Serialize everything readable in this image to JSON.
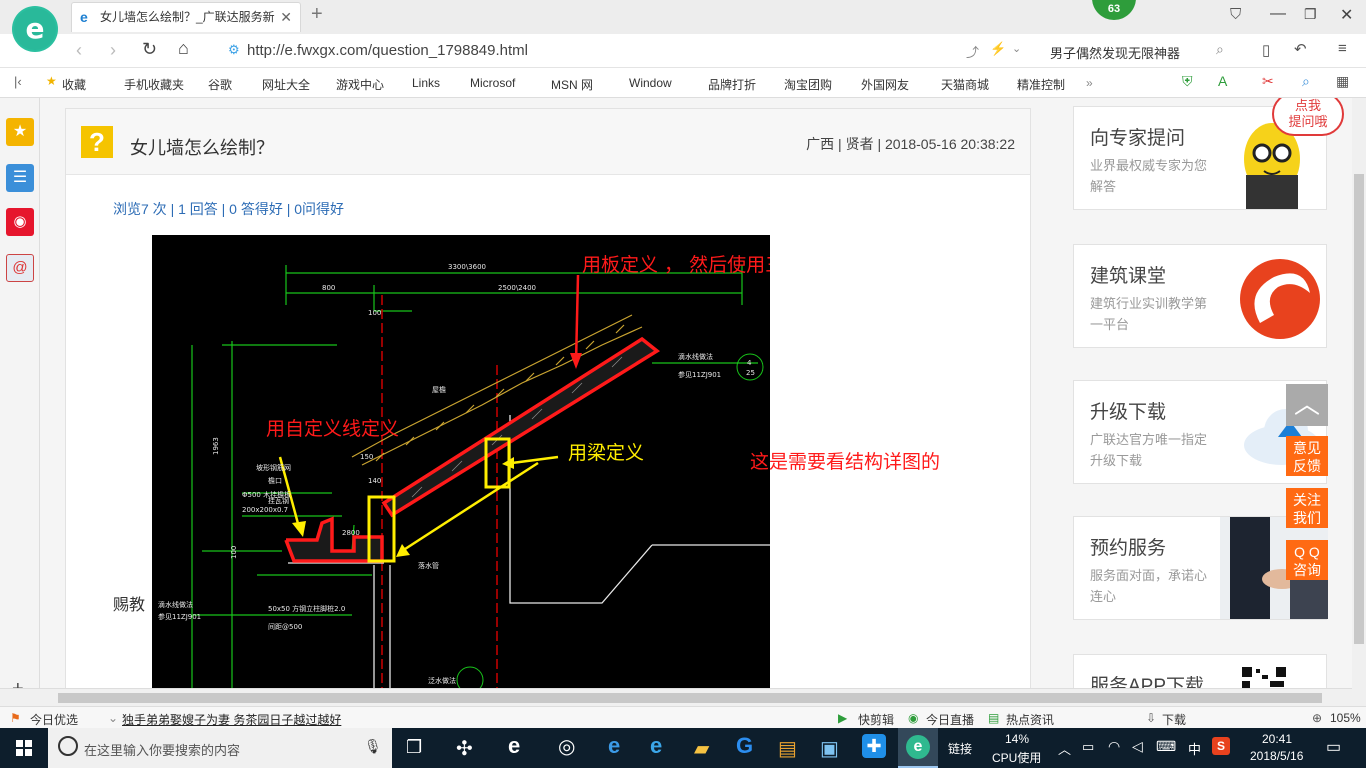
{
  "browser": {
    "tab_title": "女儿墙怎么绘制？_广联达服务新",
    "url": "http://e.fwxgx.com/question_1798849.html",
    "search_hint": "男子偶然发现无限神器",
    "badge": "63"
  },
  "bookmarks": [
    "收藏",
    "手机收藏夹",
    "谷歌",
    "网址大全",
    "游戏中心",
    "Links",
    "Microsof",
    "MSN 网",
    "Window",
    "品牌打折",
    "淘宝团购",
    "外国网友",
    "天猫商城",
    "精准控制"
  ],
  "question": {
    "title": "女儿墙怎么绘制？",
    "meta": "广西 | 贤者 | 2018-05-16 20:38:22",
    "stats": "浏览7 次 | 1 回答 | 0 答得好 | 0问得好",
    "side_text": "赐教"
  },
  "drawing": {
    "note_slab": "用板定义 ， 然后使用三点定义斜板功能",
    "note_line": "用自定义线定义",
    "note_beam": "用梁定义",
    "note_struct": "这是需要看结构详图的",
    "dims": [
      "3300\\3600",
      "800",
      "2500\\2400",
      "100",
      "1963",
      "100",
      "2800",
      "150",
      "140"
    ],
    "cad_labels": [
      "滴水线做法",
      "参见11ZJ901",
      "屋檐",
      "坡形钢筋网",
      "Φ500 木挂檐板",
      "200x200x0.7",
      "檐口",
      "挂瓦钢",
      "滴水线做法",
      "参见11ZJ901",
      "50x50 方钢立柱脚桩2.0",
      "间距@500",
      "落水管",
      "泛水做法",
      "4",
      "25"
    ]
  },
  "sidebar": {
    "ask_badge": "点我\n提问哦",
    "cards": [
      {
        "title": "向专家提问",
        "desc": "业界最权威专家为您解答"
      },
      {
        "title": "建筑课堂",
        "desc": "建筑行业实训教学第一平台"
      },
      {
        "title": "升级下载",
        "desc": "广联达官方唯一指定升级下载"
      },
      {
        "title": "预约服务",
        "desc": "服务面对面，承诺心连心"
      },
      {
        "title": "服务APP下载",
        "desc": ""
      }
    ],
    "buttons": [
      "意见反馈",
      "关注我们",
      "Q Q咨询"
    ]
  },
  "statusbar": {
    "left": "今日优选",
    "news": "独手弟弟娶嫂子为妻 务茶园日子越过越好",
    "items": [
      "快剪辑",
      "今日直播",
      "热点资讯",
      "下载"
    ],
    "zoom": "105%"
  },
  "taskbar": {
    "search": "在这里输入你要搜索的内容",
    "link": "链接",
    "cpu_pct": "14%",
    "cpu_label": "CPU使用",
    "ime": "中",
    "time": "20:41",
    "date": "2018/5/16"
  },
  "colors": {
    "accent": "#ff6a13",
    "cad_red": "#ff1a1a",
    "cad_yellow": "#ffee00",
    "cad_green": "#18c41a",
    "link_blue": "#2d6cb5"
  }
}
